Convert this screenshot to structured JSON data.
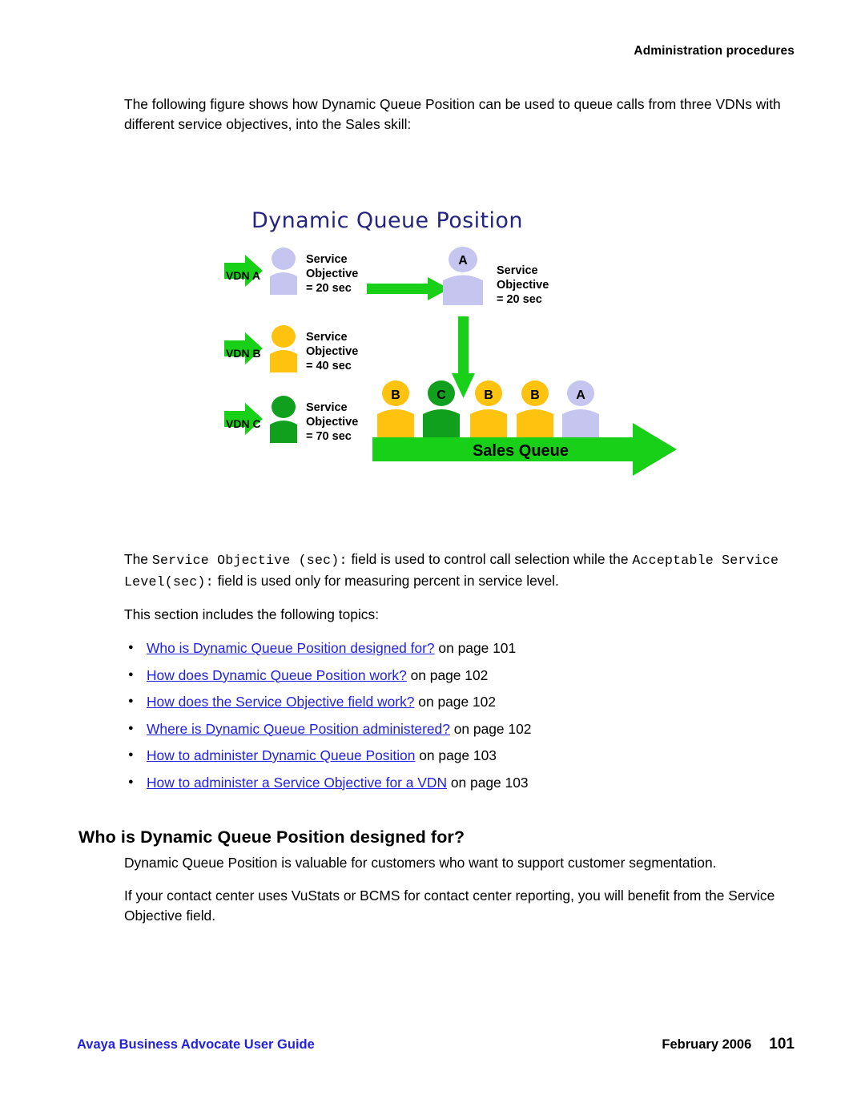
{
  "header": {
    "running_title": "Administration procedures"
  },
  "intro": {
    "paragraph": "The following figure shows how Dynamic Queue Position can be used to queue calls from three VDNs with different service objectives, into the Sales skill:"
  },
  "figure": {
    "title": "Dynamic Queue Position",
    "sources": [
      {
        "vdn_label": "VDN A",
        "objective_line1": "Service",
        "objective_line2": "Objective",
        "objective_line3": "= 20 sec",
        "color": "#C5C5F0"
      },
      {
        "vdn_label": "VDN B",
        "objective_line1": "Service",
        "objective_line2": "Objective",
        "objective_line3": "= 40 sec",
        "color": "#FFC20E"
      },
      {
        "vdn_label": "VDN C",
        "objective_line1": "Service",
        "objective_line2": "Objective",
        "objective_line3": "= 70 sec",
        "color": "#11A01D"
      }
    ],
    "agent": {
      "badge": "A",
      "objective_line1": "Service",
      "objective_line2": "Objective",
      "objective_line3": "= 20 sec",
      "color": "#C5C5F0"
    },
    "queue_label": "Sales Queue",
    "queue": [
      {
        "badge": "B",
        "color": "#FFC20E"
      },
      {
        "badge": "C",
        "color": "#11A01D"
      },
      {
        "badge": "B",
        "color": "#FFC20E"
      },
      {
        "badge": "B",
        "color": "#FFC20E"
      },
      {
        "badge": "A",
        "color": "#C5C5F0"
      }
    ],
    "colors": {
      "arrow_green": "#17D017",
      "arrow_green_dark": "#00BB00",
      "title_blue": "#252580"
    }
  },
  "body": {
    "field_para_pre": "The ",
    "field_para_mono1": "Service Objective (sec):",
    "field_para_mid": " field is used to control call selection while the",
    "field_para_mono2": "Acceptable Service Level(sec):",
    "field_para_post": " field is used only for measuring percent in service level.",
    "section_intro": "This section includes the following topics:"
  },
  "topics": [
    {
      "link": "Who is Dynamic Queue Position designed for?",
      "tail": " on page 101"
    },
    {
      "link": "How does Dynamic Queue Position work?",
      "tail": " on page 102"
    },
    {
      "link": "How does the Service Objective field work?",
      "tail": " on page 102"
    },
    {
      "link": "Where is Dynamic Queue Position administered?",
      "tail": " on page 102"
    },
    {
      "link": "How to administer Dynamic Queue Position",
      "tail": " on page 103"
    },
    {
      "link": "How to administer a Service Objective for a VDN",
      "tail": " on page 103"
    }
  ],
  "section": {
    "heading": "Who is Dynamic Queue Position designed for?",
    "paragraph_1": "Dynamic Queue Position is valuable for customers who want to support customer segmentation.",
    "paragraph_2": "If your contact center uses VuStats or BCMS for contact center reporting, you will benefit from the Service Objective field."
  },
  "footer": {
    "guide_title": "Avaya Business Advocate User Guide",
    "date": "February 2006",
    "page_number": "101"
  }
}
